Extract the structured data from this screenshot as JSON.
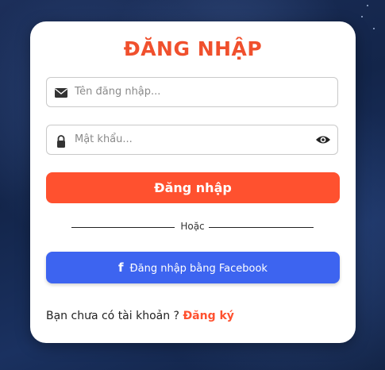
{
  "login": {
    "title": "ĐĂNG NHẬP",
    "username_placeholder": "Tên đăng nhập...",
    "password_placeholder": "Mật khẩu...",
    "login_button": "Đăng nhập",
    "divider_text": "Hoặc",
    "facebook_button": "Đăng nhập bằng Facebook",
    "signup_prompt": "Bạn chưa có tài khoản ? ",
    "signup_link": "Đăng ký"
  },
  "icons": {
    "username": "envelope-icon",
    "password": "lock-icon",
    "toggle": "eye-icon",
    "facebook": "facebook-icon"
  },
  "colors": {
    "accent": "#ff512f",
    "facebook": "#3d64f0"
  }
}
